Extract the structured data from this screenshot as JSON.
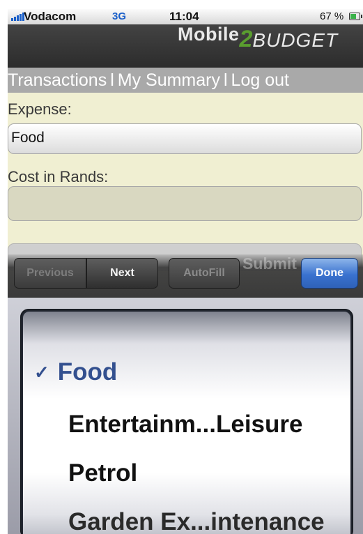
{
  "status_bar": {
    "carrier": "Vodacom",
    "network": "3G",
    "time": "11:04",
    "battery": "67 %"
  },
  "header": {
    "logo_part1": "Mobile",
    "logo_part2": "2",
    "logo_part3": "BUDGET"
  },
  "nav": {
    "items": [
      "Transactions",
      "My Summary",
      "Log out"
    ],
    "separator": "l"
  },
  "form": {
    "expense_label": "Expense:",
    "expense_value": "Food",
    "cost_label": "Cost in Rands:",
    "cost_value": "",
    "submit_label": "Submit"
  },
  "toolbar": {
    "previous": "Previous",
    "next": "Next",
    "autofill": "AutoFill",
    "done": "Done"
  },
  "picker": {
    "check": "✓",
    "options": [
      "Food",
      "Entertainm...Leisure",
      "Petrol",
      "Garden Ex...intenance"
    ],
    "selected_index": 0
  },
  "colors": {
    "accent": "#3a72cf",
    "logo_green": "#5a9e2f",
    "page_background": "#f0efd2"
  }
}
